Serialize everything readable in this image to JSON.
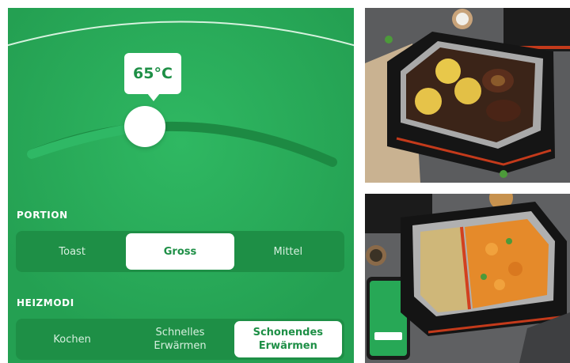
{
  "temperature": {
    "value": "65°C"
  },
  "portion": {
    "label": "PORTION",
    "options": [
      "Toast",
      "Gross",
      "Mittel"
    ],
    "selected": "Gross"
  },
  "heating_modes": {
    "label": "HEIZMODI",
    "options": [
      "Kochen",
      "Schnelles\nErwärmen",
      "Schonendes\nErwärmen"
    ],
    "selected": "Schonendes\nErwärmen"
  },
  "colors": {
    "panel_green": "#27a856",
    "segment_green": "#1e8f46",
    "accent_red": "#d2401f"
  }
}
